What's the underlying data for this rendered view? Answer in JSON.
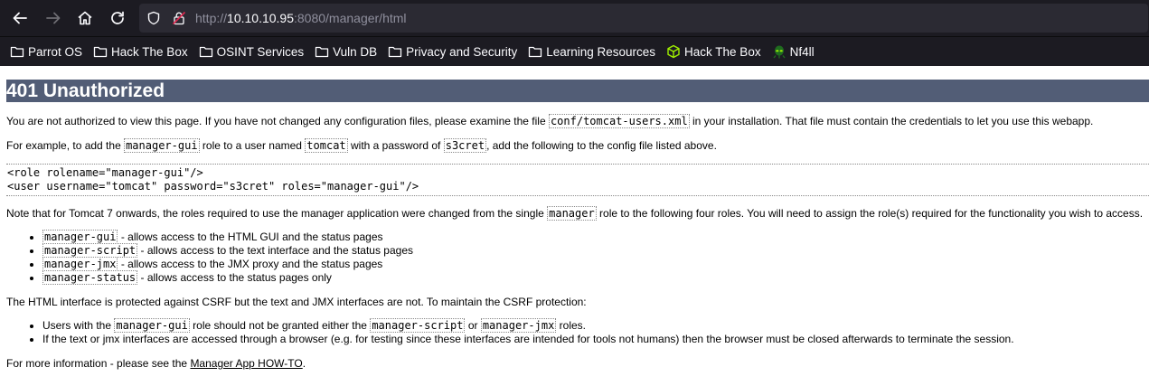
{
  "browser": {
    "url_prefix": "http://",
    "url_host": "10.10.10.95",
    "url_rest": ":8080/manager/html",
    "bookmarks": [
      {
        "label": "Parrot OS",
        "icon": "folder-icon"
      },
      {
        "label": "Hack The Box",
        "icon": "folder-icon"
      },
      {
        "label": "OSINT Services",
        "icon": "folder-icon"
      },
      {
        "label": "Vuln DB",
        "icon": "folder-icon"
      },
      {
        "label": "Privacy and Security",
        "icon": "folder-icon"
      },
      {
        "label": "Learning Resources",
        "icon": "folder-icon"
      },
      {
        "label": "Hack The Box",
        "icon": "htb-cube-icon"
      },
      {
        "label": "Nf4ll",
        "icon": "alien-icon"
      }
    ]
  },
  "content": {
    "title": "401 Unauthorized",
    "p1_a": "You are not authorized to view this page. If you have not changed any configuration files, please examine the file ",
    "p1_code": "conf/tomcat-users.xml",
    "p1_b": " in your installation. That file must contain the credentials to let you use this webapp.",
    "p2_a": "For example, to add the ",
    "p2_code1": "manager-gui",
    "p2_b": " role to a user named ",
    "p2_code2": "tomcat",
    "p2_c": " with a password of ",
    "p2_code3": "s3cret",
    "p2_d": ", add the following to the config file listed above.",
    "cfg_line1": "<role rolename=\"manager-gui\"/>",
    "cfg_line2": "<user username=\"tomcat\" password=\"s3cret\" roles=\"manager-gui\"/>",
    "p3_a": "Note that for Tomcat 7 onwards, the roles required to use the manager application were changed from the single ",
    "p3_code": "manager",
    "p3_b": " role to the following four roles. You will need to assign the role(s) required for the functionality you wish to access.",
    "roles": [
      {
        "role": "manager-gui",
        "desc": " - allows access to the HTML GUI and the status pages"
      },
      {
        "role": "manager-script",
        "desc": " - allows access to the text interface and the status pages"
      },
      {
        "role": "manager-jmx",
        "desc": " - allows access to the JMX proxy and the status pages"
      },
      {
        "role": "manager-status",
        "desc": " - allows access to the status pages only"
      }
    ],
    "p4": "The HTML interface is protected against CSRF but the text and JMX interfaces are not. To maintain the CSRF protection:",
    "csrf1_a": "Users with the ",
    "csrf1_code1": "manager-gui",
    "csrf1_b": " role should not be granted either the ",
    "csrf1_code2": "manager-script",
    "csrf1_c": " or ",
    "csrf1_code3": "manager-jmx",
    "csrf1_d": " roles.",
    "csrf2": "If the text or jmx interfaces are accessed through a browser (e.g. for testing since these interfaces are intended for tools not humans) then the browser must be closed afterwards to terminate the session.",
    "p5_a": "For more information - please see the ",
    "p5_link": "Manager App HOW-TO",
    "p5_b": "."
  },
  "colors": {
    "chrome_bg": "#1c1b22",
    "urlbar_bg": "#2b2a33",
    "title_bar": "#525d76"
  }
}
